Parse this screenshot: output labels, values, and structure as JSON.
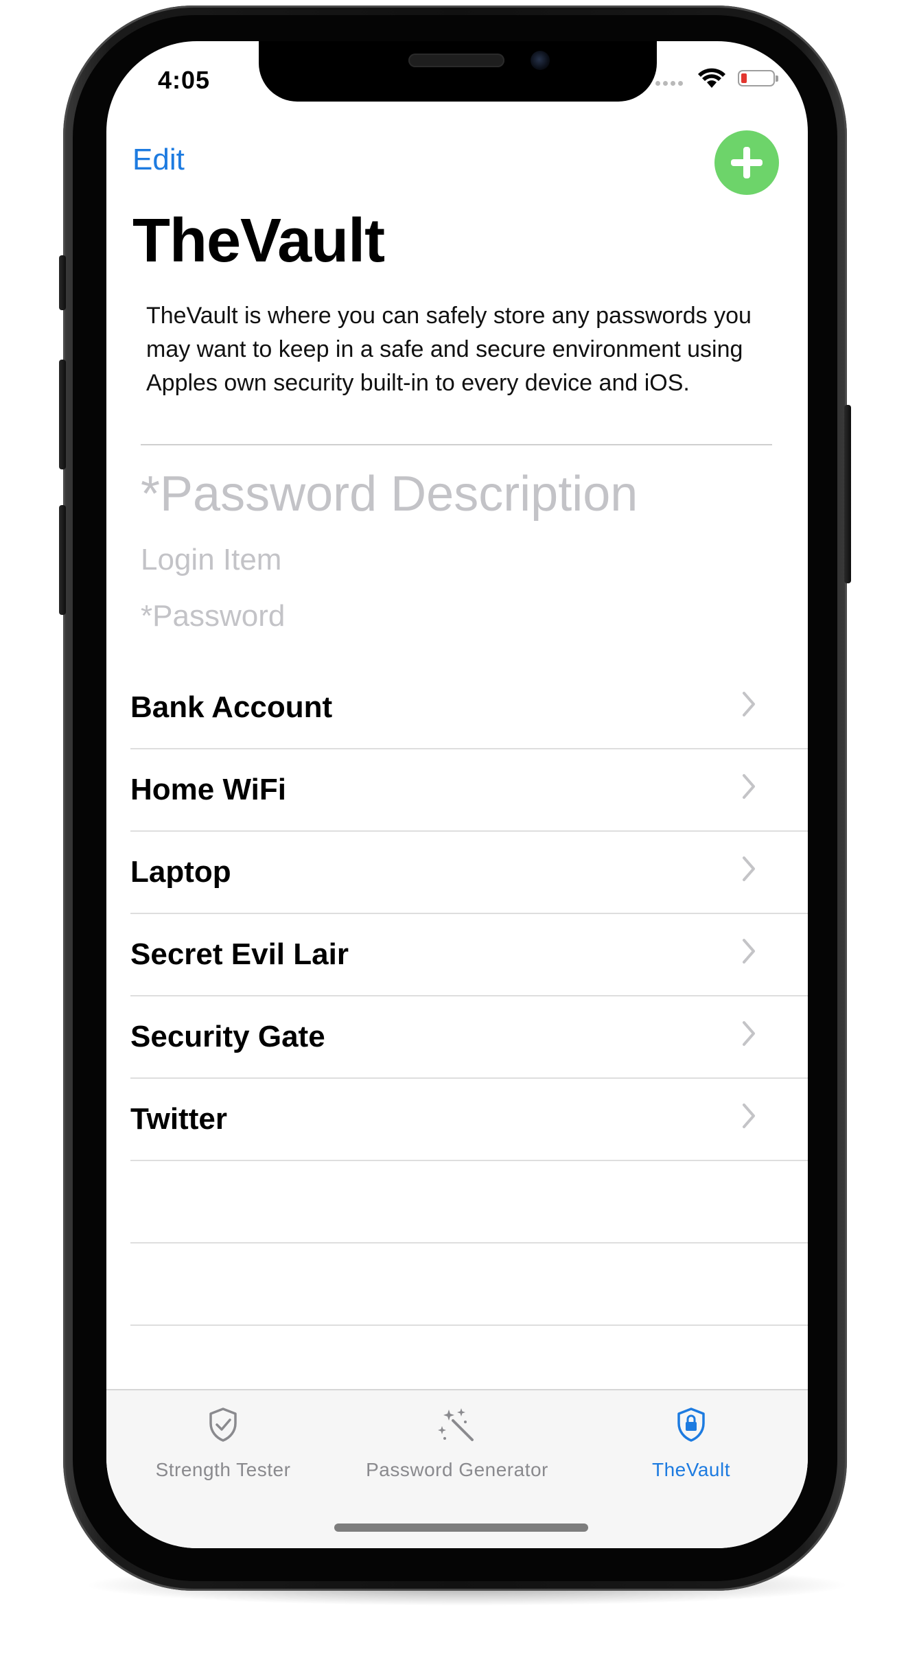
{
  "status_bar": {
    "time": "4:05"
  },
  "nav": {
    "edit_label": "Edit",
    "add_button_color": "#6dd46a"
  },
  "page": {
    "title": "TheVault",
    "description": "TheVault is where you can safely store any passwords you may want to keep in a safe and secure environment using Apples own security built-in to every device and iOS."
  },
  "form": {
    "description_placeholder": "*Password Description",
    "login_placeholder": "Login Item",
    "password_placeholder": "*Password"
  },
  "vault_items": [
    {
      "label": "Bank Account"
    },
    {
      "label": "Home WiFi"
    },
    {
      "label": "Laptop"
    },
    {
      "label": "Secret Evil Lair"
    },
    {
      "label": "Security Gate"
    },
    {
      "label": "Twitter"
    }
  ],
  "tab_bar": {
    "tabs": [
      {
        "label": "Strength Tester",
        "icon": "shield-check-icon",
        "active": false
      },
      {
        "label": "Password Generator",
        "icon": "magic-wand-icon",
        "active": false
      },
      {
        "label": "TheVault",
        "icon": "shield-lock-icon",
        "active": true
      }
    ]
  },
  "colors": {
    "accent": "#1d7be0",
    "add_button": "#6dd46a",
    "battery_low": "#e2362f"
  }
}
